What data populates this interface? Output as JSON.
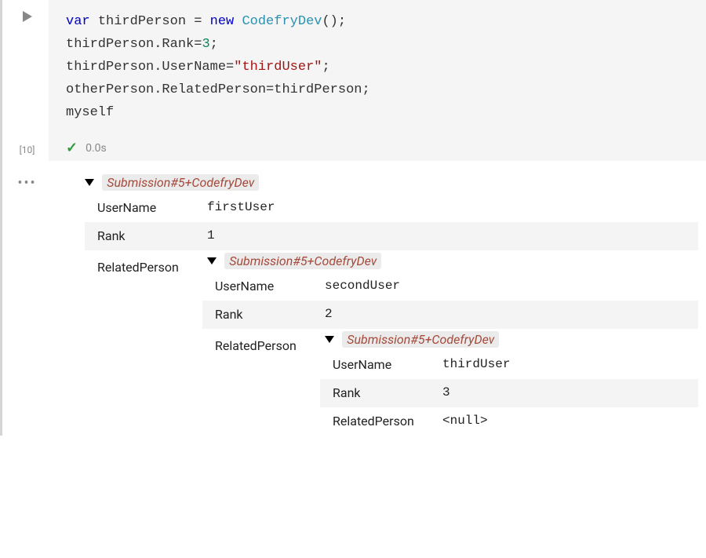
{
  "execution_count": "[10]",
  "timing": "0.0s",
  "code": {
    "line1": {
      "kw": "var",
      "id1": "thirdPerson",
      "assign": " = ",
      "kw2": "new",
      "typ": "CodefryDev",
      "end": "();"
    },
    "line2": {
      "obj": "thirdPerson",
      "prop": "Rank",
      "eq": "=",
      "val": "3",
      "end": ";"
    },
    "line3": {
      "obj": "thirdPerson",
      "prop": "UserName",
      "eq": "=",
      "str": "\"thirdUser\"",
      "end": ";"
    },
    "line4": {
      "obj": "otherPerson",
      "prop": "RelatedPerson",
      "eq": "=",
      "val": "thirdPerson",
      "end": ";"
    },
    "line5": "myself"
  },
  "type_label": "Submission#5+CodefryDev",
  "labels": {
    "UserName": "UserName",
    "Rank": "Rank",
    "RelatedPerson": "RelatedPerson"
  },
  "obj1": {
    "UserName": "firstUser",
    "Rank": "1",
    "RelatedPerson": {
      "UserName": "secondUser",
      "Rank": "2",
      "RelatedPerson": {
        "UserName": "thirdUser",
        "Rank": "3",
        "RelatedPerson": "<null>"
      }
    }
  }
}
